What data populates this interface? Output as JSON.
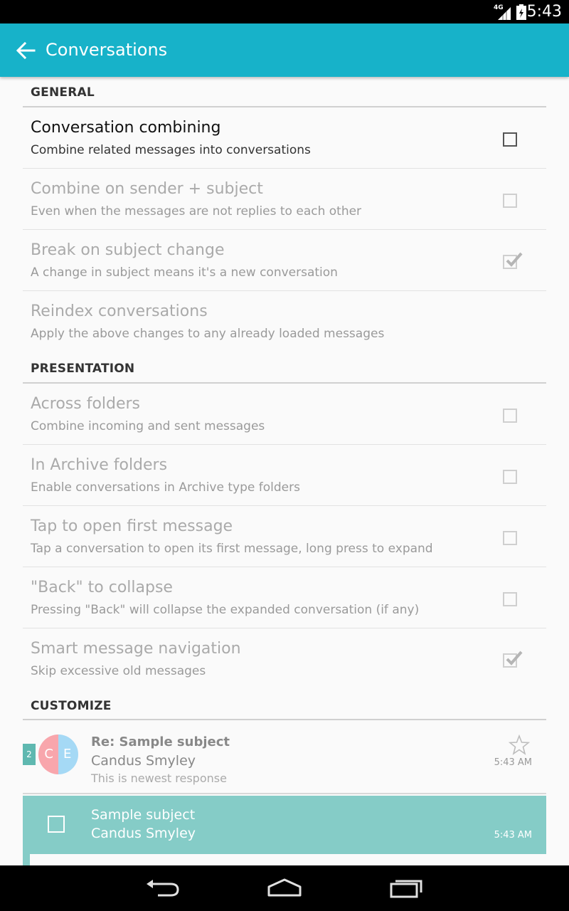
{
  "status_bar": {
    "network": "4G",
    "time": "5:43",
    "icons": [
      "signal-icon",
      "battery-icon"
    ]
  },
  "app_bar": {
    "title": "Conversations",
    "background": "#17b2c9",
    "back_icon": "arrow-back-icon"
  },
  "sections": [
    {
      "header": "GENERAL",
      "items": [
        {
          "title": "Conversation combining",
          "summary": "Combine related messages into conversations",
          "enabled": true,
          "checkbox": true,
          "checked": false
        },
        {
          "title": "Combine on sender + subject",
          "summary": "Even when the messages are not replies to each other",
          "enabled": false,
          "checkbox": true,
          "checked": false
        },
        {
          "title": "Break on subject change",
          "summary": "A change in subject means it's a new conversation",
          "enabled": false,
          "checkbox": true,
          "checked": true
        },
        {
          "title": "Reindex conversations",
          "summary": "Apply the above changes to any already loaded messages",
          "enabled": false,
          "checkbox": false,
          "checked": false
        }
      ]
    },
    {
      "header": "PRESENTATION",
      "items": [
        {
          "title": "Across folders",
          "summary": "Combine incoming and sent messages",
          "enabled": false,
          "checkbox": true,
          "checked": false
        },
        {
          "title": "In Archive folders",
          "summary": "Enable conversations in Archive type folders",
          "enabled": false,
          "checkbox": true,
          "checked": false
        },
        {
          "title": "Tap to open first message",
          "summary": "Tap a conversation to open its first message, long press to expand",
          "enabled": false,
          "checkbox": true,
          "checked": false
        },
        {
          "title": "\"Back\" to collapse",
          "summary": "Pressing \"Back\" will collapse the expanded conversation (if any)",
          "enabled": false,
          "checkbox": true,
          "checked": false
        },
        {
          "title": "Smart message navigation",
          "summary": "Skip excessive old messages",
          "enabled": false,
          "checkbox": true,
          "checked": true
        }
      ]
    },
    {
      "header": "CUSTOMIZE",
      "items": []
    }
  ],
  "preview": {
    "conversation": {
      "count": "2",
      "avatar_letters": [
        "C",
        "E"
      ],
      "subject": "Re: Sample subject",
      "sender": "Candus Smyley",
      "snippet": "This is newest response",
      "time": "5:43 AM",
      "star_icon": "star-outline-icon"
    },
    "selected": {
      "subject": "Sample subject",
      "sender": "Candus Smyley",
      "time": "5:43 AM",
      "background": "#85ccc7"
    }
  },
  "nav_bar": {
    "buttons": [
      "back-nav-icon",
      "home-nav-icon",
      "recents-nav-icon"
    ]
  }
}
